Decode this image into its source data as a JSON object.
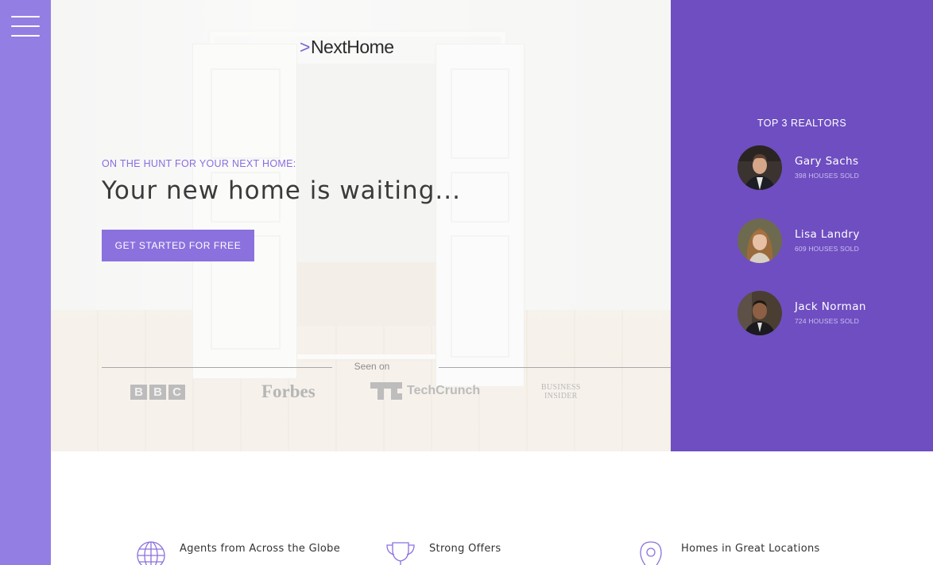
{
  "brand": {
    "name": "NextHome",
    "arrow": ">"
  },
  "menu": {
    "icon": "hamburger-menu-icon"
  },
  "hero": {
    "kicker": "ON THE HUNT FOR YOUR NEXT HOME:",
    "headline": "Your new home is waiting...",
    "cta_label": "GET STARTED FOR FREE",
    "seen_on": "Seen on",
    "press": {
      "bbc": [
        "B",
        "B",
        "C"
      ],
      "forbes": "Forbes",
      "techcrunch": "TechCrunch",
      "business_insider_line1": "BUSINESS",
      "business_insider_line2": "INSIDER"
    }
  },
  "realtors": {
    "title": "TOP 3 REALTORS",
    "items": [
      {
        "name": "Gary Sachs",
        "sold": "398 HOUSES SOLD"
      },
      {
        "name": "Lisa Landry",
        "sold": "609 HOUSES SOLD"
      },
      {
        "name": "Jack Norman",
        "sold": "724 HOUSES SOLD"
      }
    ]
  },
  "features": [
    {
      "label": "Agents from Across the Globe",
      "icon": "globe-icon"
    },
    {
      "label": "Strong Offers",
      "icon": "trophy-icon"
    },
    {
      "label": "Homes in Great Locations",
      "icon": "location-pin-icon"
    }
  ],
  "colors": {
    "sidebar": "#937ee4",
    "panel": "#6f4ec1",
    "accent": "#8b71de"
  }
}
